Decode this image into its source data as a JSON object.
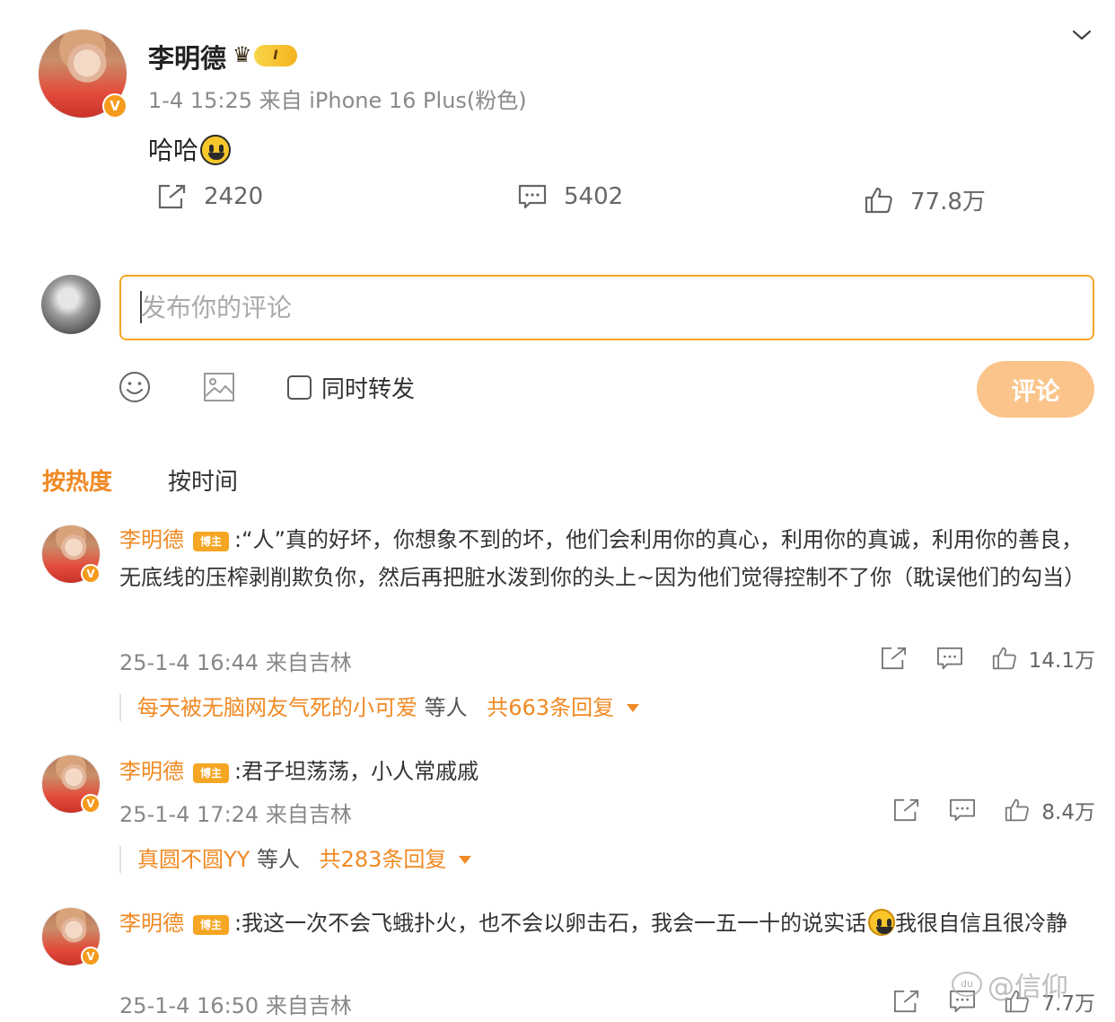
{
  "post": {
    "author": "李明德",
    "level": "I",
    "meta": "1-4 15:25 来自 iPhone 16 Plus(粉色)",
    "text": "哈哈",
    "text_emoji": "grinning-face",
    "reposts": "2420",
    "comments": "5402",
    "likes": "77.8万"
  },
  "compose": {
    "placeholder": "发布你的评论",
    "repost_label": "同时转发",
    "submit_label": "评论"
  },
  "sort": {
    "hot": "按热度",
    "time": "按时间"
  },
  "comments": [
    {
      "author": "李明德",
      "tag": "博主",
      "text": ":“人”真的好坏，你想象不到的坏，他们会利用你的真心，利用你的真诚，利用你的善良，无底线的压榨剥削欺负你，然后再把脏水泼到你的头上~因为他们觉得控制不了你（耽误他们的勾当）",
      "meta": "25-1-4 16:44 来自吉林",
      "likes": "14.1万",
      "reply_user": "每天被无脑网友气死的小可爱",
      "reply_mid": " 等人 ",
      "reply_count": "共663条回复"
    },
    {
      "author": "李明德",
      "tag": "博主",
      "text": ":君子坦荡荡，小人常戚戚",
      "meta": "25-1-4 17:24 来自吉林",
      "likes": "8.4万",
      "reply_user": "真圆不圆YY",
      "reply_mid": " 等人 ",
      "reply_count": "共283条回复"
    },
    {
      "author": "李明德",
      "tag": "博主",
      "text_a": ":我这一次不会飞蛾扑火，也不会以卵击石，我会一五一十的说实话",
      "text_b": "我很自信且很冷静",
      "meta": "25-1-4 16:50 来自吉林",
      "likes": "7.7万"
    }
  ],
  "watermark": "@信仰",
  "colors": {
    "accent": "#f08a24",
    "input_border": "#f5a623",
    "submit_bg": "#fbc48a"
  }
}
